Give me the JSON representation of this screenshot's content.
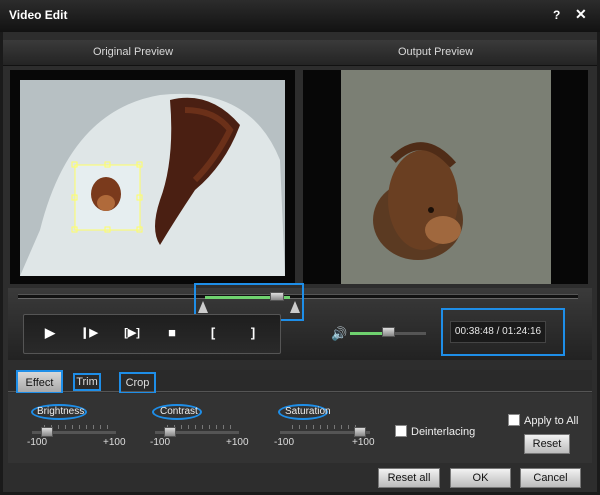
{
  "window": {
    "title": "Video Edit",
    "help": "?",
    "close": "✕"
  },
  "preview": {
    "original_label": "Original Preview",
    "output_label": "Output Preview"
  },
  "playback": {
    "play": "▶",
    "step": "❙▶",
    "frame": "[▶]",
    "stop": "■",
    "mark_in": "[",
    "mark_out": "]",
    "volume_icon": "🔊",
    "time": "00:38:48 / 01:24:16"
  },
  "tabs": {
    "effect": "Effect",
    "trim": "Trim",
    "crop": "Crop"
  },
  "effect": {
    "brightness": {
      "label": "Brightness",
      "min": "-100",
      "max": "+100"
    },
    "contrast": {
      "label": "Contrast",
      "min": "-100",
      "max": "+100"
    },
    "saturation": {
      "label": "Saturation",
      "min": "-100",
      "max": "+100"
    },
    "deinterlacing": "Deinterlacing",
    "apply_to_all": "Apply to All",
    "reset": "Reset"
  },
  "footer": {
    "reset_all": "Reset all",
    "ok": "OK",
    "cancel": "Cancel"
  },
  "colors": {
    "highlight": "#1e8ee8",
    "progress": "#6fd26f"
  }
}
